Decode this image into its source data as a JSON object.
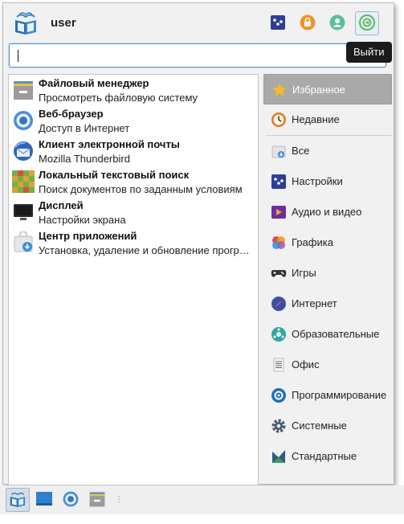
{
  "header": {
    "username": "user",
    "buttons": [
      {
        "name": "settings",
        "icon": "settings-icon"
      },
      {
        "name": "lock",
        "icon": "lock-icon"
      },
      {
        "name": "user",
        "icon": "user-icon"
      },
      {
        "name": "logout",
        "icon": "logout-icon"
      }
    ],
    "tooltip": "Выйти"
  },
  "search": {
    "value": "",
    "placeholder": ""
  },
  "favorites": [
    {
      "title": "Файловый менеджер",
      "desc": "Просмотреть файловую систему",
      "icon": "file-manager-icon"
    },
    {
      "title": "Веб-браузер",
      "desc": "Доступ в Интернет",
      "icon": "browser-icon"
    },
    {
      "title": "Клиент электронной почты",
      "desc": "Mozilla Thunderbird",
      "icon": "mail-icon"
    },
    {
      "title": "Локальный текстовый поиск",
      "desc": "Поиск документов по заданным условиям",
      "icon": "search-grid-icon"
    },
    {
      "title": "Дисплей",
      "desc": "Настройки экрана",
      "icon": "display-icon"
    },
    {
      "title": "Центр приложений",
      "desc": "Установка, удаление и обновление прогр…",
      "icon": "app-center-icon"
    }
  ],
  "categories": [
    {
      "label": "Избранное",
      "icon": "star-icon",
      "selected": true
    },
    {
      "label": "Недавние",
      "icon": "clock-icon"
    },
    {
      "label": "Все",
      "icon": "all-apps-icon"
    },
    {
      "label": "Настройки",
      "icon": "settings-icon"
    },
    {
      "label": "Аудио и видео",
      "icon": "multimedia-icon"
    },
    {
      "label": "Графика",
      "icon": "graphics-icon"
    },
    {
      "label": "Игры",
      "icon": "gamepad-icon"
    },
    {
      "label": "Интернет",
      "icon": "internet-icon"
    },
    {
      "label": "Образовательные",
      "icon": "education-icon"
    },
    {
      "label": "Офис",
      "icon": "office-icon"
    },
    {
      "label": "Программирование",
      "icon": "development-icon"
    },
    {
      "label": "Системные",
      "icon": "system-gear-icon"
    },
    {
      "label": "Стандартные",
      "icon": "accessories-icon"
    }
  ],
  "taskbar": [
    "menu-logo-icon",
    "desktop-icon",
    "browser-icon",
    "file-manager-icon"
  ],
  "colors": {
    "accent": "#5a94c8",
    "selected": "#a9a9a9",
    "tooltip": "#1b1b1b",
    "logout": "#5cb85c",
    "lock": "#f0922b"
  }
}
